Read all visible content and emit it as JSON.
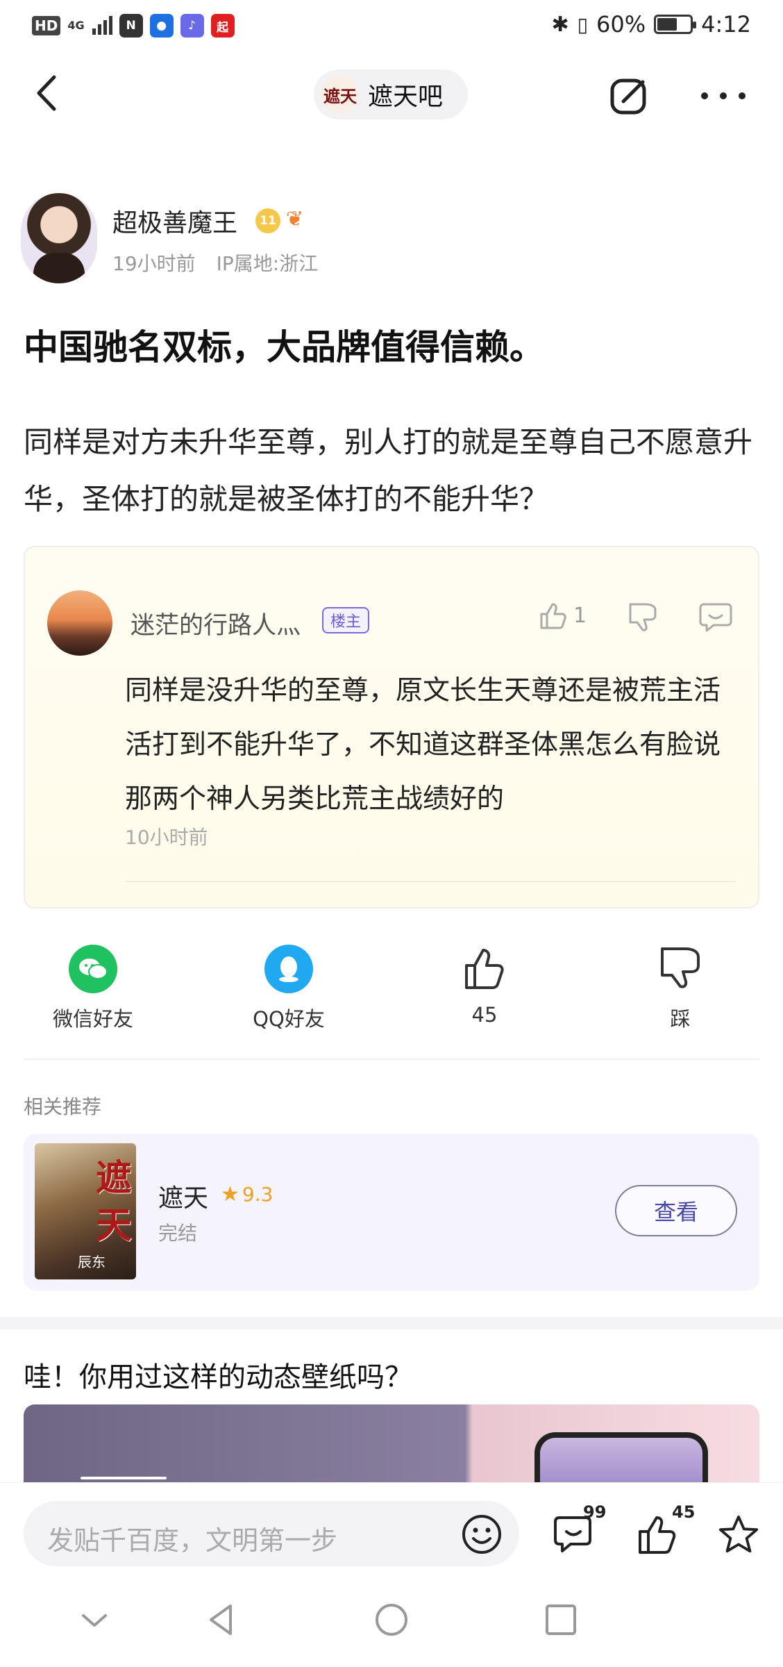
{
  "status_bar": {
    "hd": "HD",
    "network": "4G",
    "battery_text": "60%",
    "battery_level": 0.6,
    "time": "4:12"
  },
  "nav": {
    "forum_name": "遮天吧",
    "forum_logo_text": "遮天"
  },
  "author": {
    "name": "超极善魔王",
    "level": "11",
    "time": "19小时前",
    "ip": "IP属地:浙江"
  },
  "post": {
    "title": "中国驰名双标，大品牌值得信赖。",
    "body": "同样是对方未升华至尊，别人打的就是至尊自己不愿意升华，圣体打的就是被圣体打的不能升华？"
  },
  "reply": {
    "name": "迷茫的行路人灬",
    "tag": "楼主",
    "likes": "1",
    "body": "同样是没升华的至尊，原文长生天尊还是被荒主活活打到不能升华了，不知道这群圣体黑怎么有脸说那两个神人另类比荒主战绩好的",
    "time": "10小时前"
  },
  "share": {
    "wechat": "微信好友",
    "qq": "QQ好友",
    "likes": "45",
    "dislike": "踩"
  },
  "related": {
    "title": "相关推荐",
    "book_title": "遮天",
    "rating": "9.3",
    "status": "完结",
    "view_button": "查看",
    "cover_chars": [
      "遮",
      "天"
    ],
    "cover_author": "辰东"
  },
  "ad": {
    "title": "哇！你用过这样的动态壁纸吗？"
  },
  "comment_bar": {
    "placeholder": "发贴千百度，文明第一步",
    "comment_count": "99",
    "like_count": "45"
  },
  "colors": {
    "accent": "#6b5bd0",
    "wechat": "#20c160",
    "qq": "#20a8f0",
    "star": "#f0a020"
  }
}
